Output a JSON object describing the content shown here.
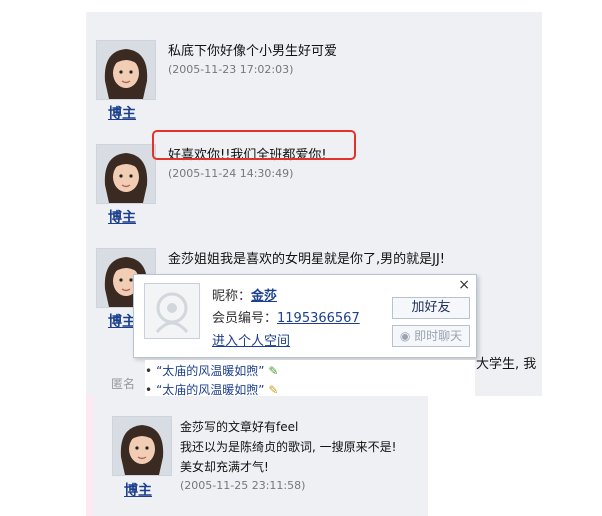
{
  "comments": [
    {
      "author": "博主",
      "message": "私底下你好像个小男生好可爱",
      "timestamp": "(2005-11-23 17:02:03)"
    },
    {
      "author": "博主",
      "message": "好喜欢你!!我们全班都爱你!",
      "timestamp": "(2005-11-24 14:30:49)"
    },
    {
      "author": "博主",
      "message": "金莎姐姐我是喜欢的女明星就是你了,男的就是JJ!"
    }
  ],
  "overflow_text": "大学生, 我",
  "anon_label": "匿名",
  "popup": {
    "nickname_label": "昵称：",
    "nickname": "金莎",
    "member_label": "会员编号：",
    "member_id": "1195366567",
    "space_link": "进入个人空间",
    "add_friend": "加好友",
    "chat": "即时聊天",
    "close": "×"
  },
  "posts": [
    {
      "title": "“太庙的风温暖如煦”"
    },
    {
      "title": "“太庙的风温暖如煦”"
    }
  ],
  "bottom_comment": {
    "author": "博主",
    "lines": [
      "金莎写的文章好有feel",
      "我还以为是陈绮贞的歌词, 一搜原来不是!",
      "美女却充满才气!"
    ],
    "timestamp": "(2005-11-25 23:11:58)"
  },
  "colors": {
    "highlight": "#e4322b",
    "link": "#1c3f8f",
    "panel": "#eef0f4"
  }
}
